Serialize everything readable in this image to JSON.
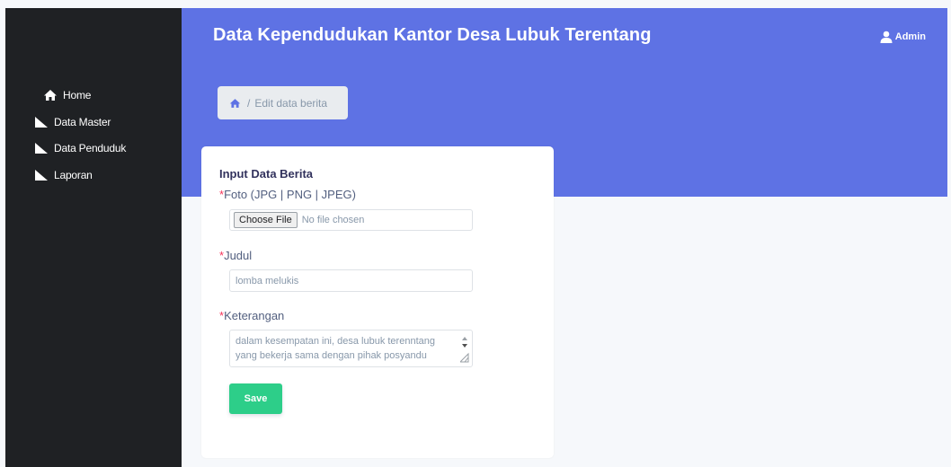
{
  "header": {
    "title": "Data Kependudukan Kantor Desa Lubuk Terentang",
    "user_label": "Admin"
  },
  "sidebar": {
    "items": [
      {
        "label": "Home",
        "icon": "home-icon"
      },
      {
        "label": "Data Master",
        "icon": "triangle-icon"
      },
      {
        "label": "Data Penduduk",
        "icon": "triangle-icon"
      },
      {
        "label": "Laporan",
        "icon": "triangle-icon"
      }
    ]
  },
  "breadcrumb": {
    "separator": "/",
    "current": "Edit data berita"
  },
  "form": {
    "title": "Input Data Berita",
    "required_mark": "*",
    "photo_label": "Foto (JPG | PNG | JPEG)",
    "file_button": "Choose File",
    "file_status": "No file chosen",
    "judul_label": "Judul",
    "judul_value": "lomba melukis",
    "keterangan_label": "Keterangan",
    "keterangan_value": "dalam kesempatan ini, desa lubuk terenntang yang bekerja sama dengan pihak posyandu",
    "save_label": "Save"
  },
  "colors": {
    "hero": "#5e72e4",
    "sidebar": "#1f2124",
    "save": "#2dce89",
    "required": "#f5365c"
  }
}
